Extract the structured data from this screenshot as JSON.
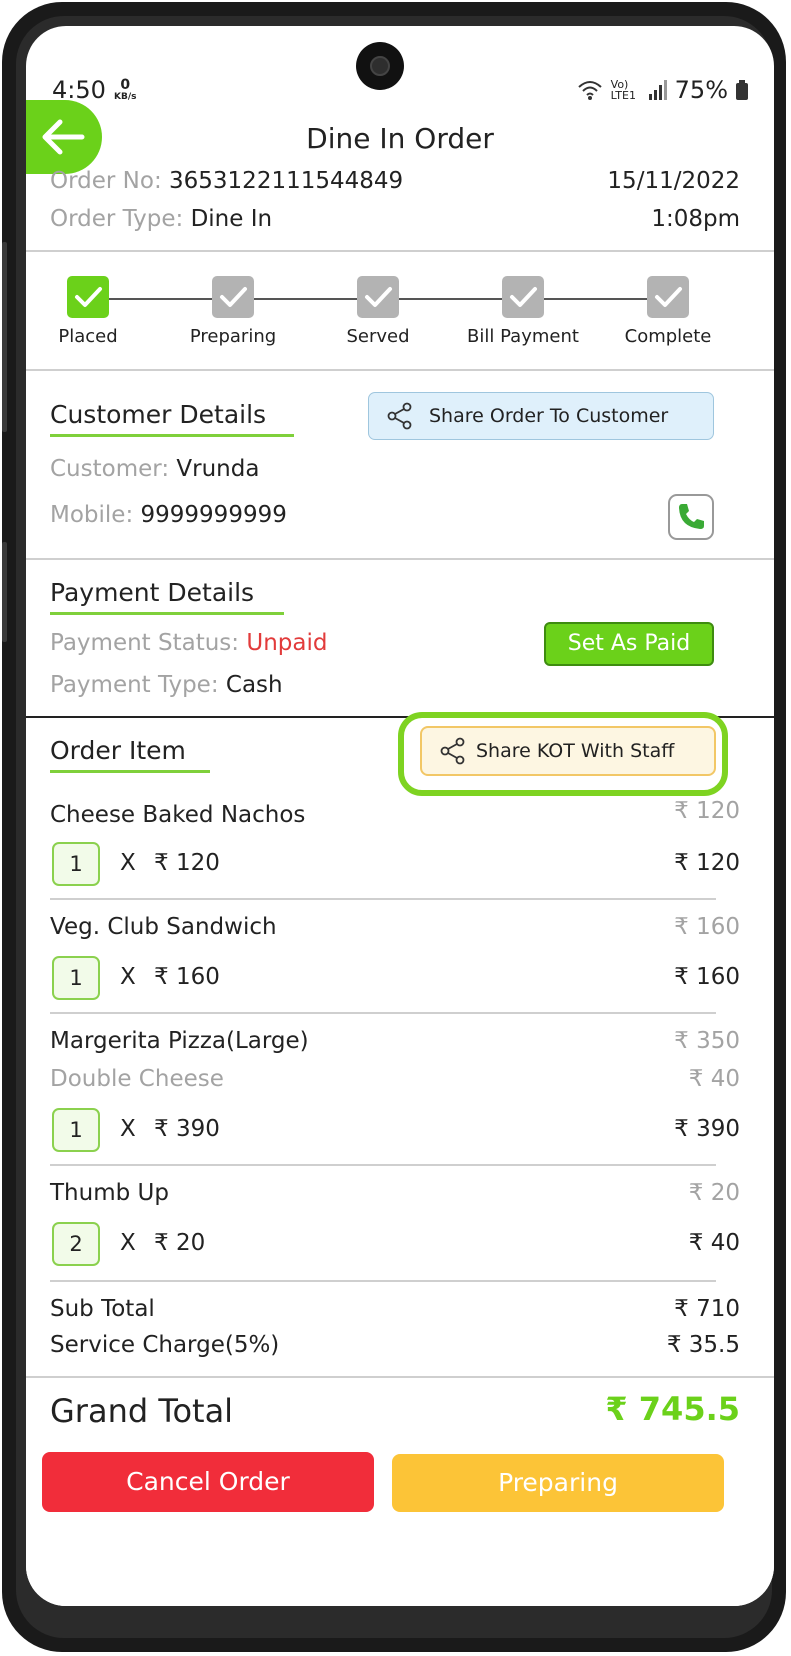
{
  "status": {
    "time": "4:50",
    "speed_value": "0",
    "speed_unit": "KB/s",
    "network": "Vo) LTE1",
    "battery": "75%"
  },
  "header": {
    "title": "Dine In Order"
  },
  "order": {
    "number_label": "Order No:",
    "number_value": "3653122111544849",
    "date": "15/11/2022",
    "type_label": "Order Type:",
    "type_value": "Dine In",
    "time": "1:08pm"
  },
  "steps": [
    {
      "label": "Placed",
      "done": true
    },
    {
      "label": "Preparing",
      "done": false
    },
    {
      "label": "Served",
      "done": false
    },
    {
      "label": "Bill Payment",
      "done": false
    },
    {
      "label": "Complete",
      "done": false
    }
  ],
  "customer": {
    "title": "Customer Details",
    "share_label": "Share Order To Customer",
    "name_label": "Customer:",
    "name_value": "Vrunda",
    "mobile_label": "Mobile:",
    "mobile_value": "9999999999"
  },
  "payment": {
    "title": "Payment Details",
    "status_label": "Payment Status:",
    "status_value": "Unpaid",
    "type_label": "Payment Type:",
    "type_value": "Cash",
    "set_paid_label": "Set As Paid"
  },
  "items_section": {
    "title": "Order Item",
    "share_kot_label": "Share KOT With Staff",
    "mult": "X"
  },
  "items": [
    {
      "name": "Cheese Baked Nachos",
      "price": "₹ 120",
      "qty": "1",
      "unit": "₹ 120",
      "total": "₹ 120"
    },
    {
      "name": "Veg. Club Sandwich",
      "price": "₹ 160",
      "qty": "1",
      "unit": "₹ 160",
      "total": "₹ 160"
    },
    {
      "name": "Margerita Pizza(Large)",
      "price": "₹ 350",
      "addon": "Double Cheese",
      "addon_price": "₹ 40",
      "qty": "1",
      "unit": "₹ 390",
      "total": "₹ 390"
    },
    {
      "name": "Thumb Up",
      "price": "₹ 20",
      "qty": "2",
      "unit": "₹ 20",
      "total": "₹ 40"
    }
  ],
  "totals": {
    "sub_label": "Sub Total",
    "sub_value": "₹ 710",
    "service_label": "Service Charge(5%)",
    "service_value": "₹ 35.5",
    "grand_label": "Grand Total",
    "grand_value": "₹ 745.5"
  },
  "actions": {
    "cancel_label": "Cancel Order",
    "preparing_label": "Preparing"
  },
  "colors": {
    "accent": "#6bd11a",
    "danger": "#f12d3a",
    "warning": "#fcc437",
    "unpaid": "#e23b3b"
  }
}
